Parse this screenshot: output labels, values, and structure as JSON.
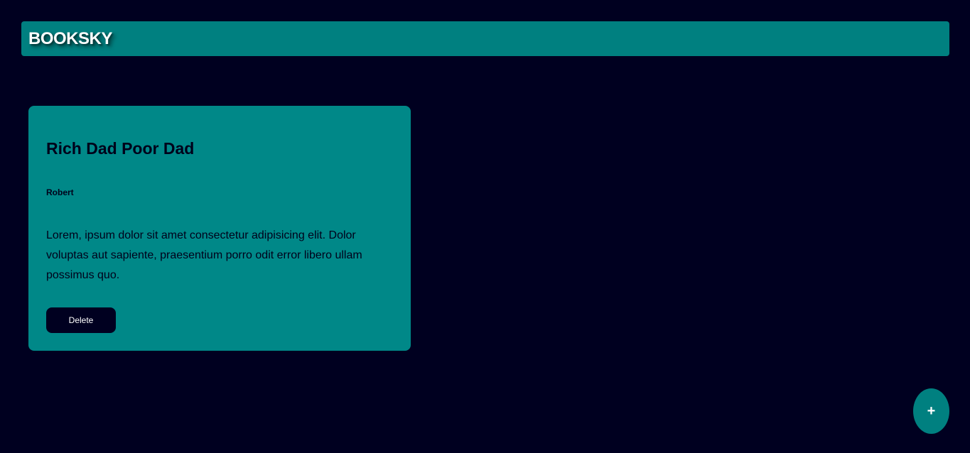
{
  "header": {
    "brand": "BOOKSKY"
  },
  "books": [
    {
      "title": "Rich Dad Poor Dad",
      "author": "Robert",
      "description": "Lorem, ipsum dolor sit amet consectetur adipisicing elit. Dolor voluptas aut sapiente, praesentium porro odit error libero ullam possimus quo.",
      "delete_label": "Delete"
    }
  ],
  "fab": {
    "label": "+"
  },
  "colors": {
    "background": "#000020",
    "accent": "#008080",
    "card": "#008888"
  }
}
